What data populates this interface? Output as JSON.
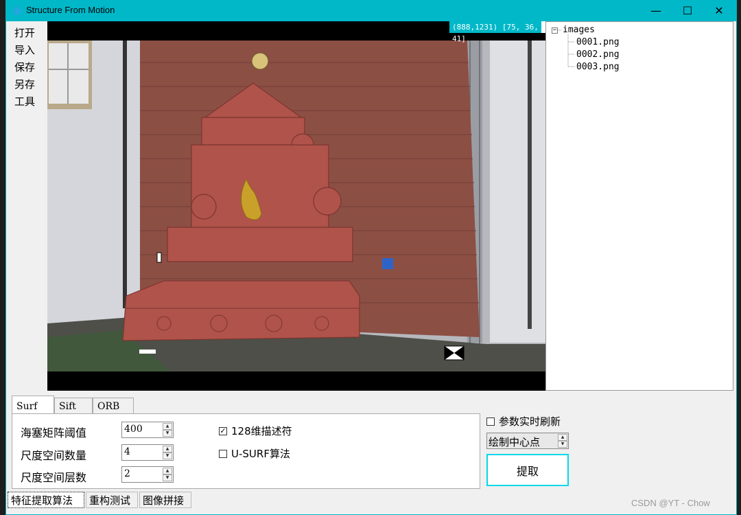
{
  "window": {
    "title": "Structure From Motion",
    "controls": {
      "minimize": "—",
      "maximize": "☐",
      "close": "✕"
    }
  },
  "menu": {
    "items": [
      "打开",
      "导入",
      "保存",
      "另存",
      "工具"
    ]
  },
  "viewer": {
    "pixel_readout": "(888,1231) [75, 36, 41]"
  },
  "file_tree": {
    "root": "images",
    "expander": "−",
    "children": [
      "0001.png",
      "0002.png",
      "0003.png"
    ]
  },
  "feature_tabs": [
    "Surf",
    "Sift",
    "ORB"
  ],
  "surf_params": {
    "hessian_label": "海塞矩阵阈值",
    "hessian_value": "400",
    "octaves_label": "尺度空间数量",
    "octaves_value": "4",
    "layers_label": "尺度空间层数",
    "layers_value": "2",
    "extended_label": "128维描述符",
    "extended_checked": true,
    "upright_label": "U-SURF算法",
    "upright_checked": false
  },
  "right_panel": {
    "realtime_label": "参数实时刷新",
    "realtime_checked": false,
    "draw_mode": "绘制中心点",
    "extract_label": "提取"
  },
  "bottom_tabs": [
    "特征提取算法",
    "重构测试",
    "图像拼接"
  ],
  "watermark": "CSDN @YT -  Chow",
  "colors": {
    "titlebar": "#00b8c8",
    "accent": "#00d8e8"
  }
}
